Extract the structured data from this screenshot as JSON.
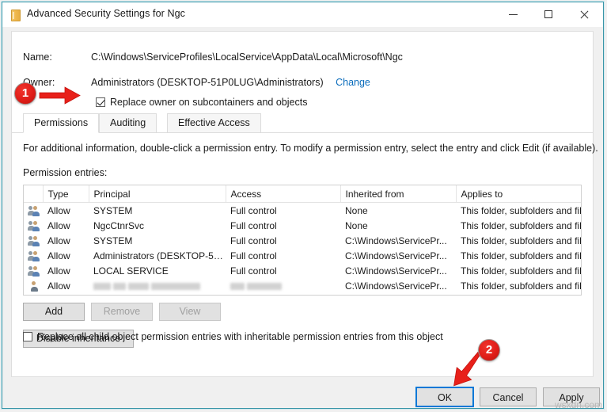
{
  "window": {
    "title": "Advanced Security Settings for Ngc",
    "icon": "folder-icon",
    "controls": {
      "minimize": "minimize-icon",
      "maximize": "maximize-icon",
      "close": "close-icon"
    }
  },
  "header": {
    "name_label": "Name:",
    "name_value": "C:\\Windows\\ServiceProfiles\\LocalService\\AppData\\Local\\Microsoft\\Ngc",
    "owner_label": "Owner:",
    "owner_value": "Administrators (DESKTOP-51P0LUG\\Administrators)",
    "change_link": "Change",
    "replace_owner_checkbox": {
      "label": "Replace owner on subcontainers and objects",
      "checked": true
    }
  },
  "tabs": [
    {
      "label": "Permissions",
      "active": true
    },
    {
      "label": "Auditing",
      "active": false
    },
    {
      "label": "Effective Access",
      "active": false
    }
  ],
  "permissions_tab": {
    "info_text": "For additional information, double-click a permission entry. To modify a permission entry, select the entry and click Edit (if available).",
    "entries_label": "Permission entries:",
    "columns": [
      "",
      "Type",
      "Principal",
      "Access",
      "Inherited from",
      "Applies to"
    ],
    "rows": [
      {
        "icon": "group-icon",
        "type": "Allow",
        "principal": "SYSTEM",
        "access": "Full control",
        "inherited_from": "None",
        "applies_to": "This folder, subfolders and files",
        "redacted": false
      },
      {
        "icon": "group-icon",
        "type": "Allow",
        "principal": "NgcCtnrSvc",
        "access": "Full control",
        "inherited_from": "None",
        "applies_to": "This folder, subfolders and files",
        "redacted": false
      },
      {
        "icon": "group-icon",
        "type": "Allow",
        "principal": "SYSTEM",
        "access": "Full control",
        "inherited_from": "C:\\Windows\\ServicePr...",
        "applies_to": "This folder, subfolders and files",
        "redacted": false
      },
      {
        "icon": "group-icon",
        "type": "Allow",
        "principal": "Administrators (DESKTOP-51P...",
        "access": "Full control",
        "inherited_from": "C:\\Windows\\ServicePr...",
        "applies_to": "This folder, subfolders and files",
        "redacted": false
      },
      {
        "icon": "group-icon",
        "type": "Allow",
        "principal": "LOCAL SERVICE",
        "access": "Full control",
        "inherited_from": "C:\\Windows\\ServicePr...",
        "applies_to": "This folder, subfolders and files",
        "redacted": false
      },
      {
        "icon": "user-icon",
        "type": "Allow",
        "principal": "",
        "access": "",
        "inherited_from": "C:\\Windows\\ServicePr...",
        "applies_to": "This folder, subfolders and files",
        "redacted": true
      }
    ],
    "buttons": {
      "add": "Add",
      "remove": "Remove",
      "view": "View",
      "disable_inheritance": "Disable inheritance"
    },
    "replace_child_checkbox": {
      "label": "Replace all child object permission entries with inheritable permission entries from this object",
      "checked": false
    }
  },
  "footer": {
    "ok": "OK",
    "cancel": "Cancel",
    "apply": "Apply"
  },
  "annotations": [
    {
      "number": "1",
      "target": "replace-owner-checkbox"
    },
    {
      "number": "2",
      "target": "ok-button"
    }
  ],
  "watermark": "wsxdn.com",
  "colors": {
    "accent_link": "#0a6cbc",
    "window_border": "#3a96a8",
    "focus_blue": "#0078d7",
    "annotation_red": "#e01d18"
  }
}
